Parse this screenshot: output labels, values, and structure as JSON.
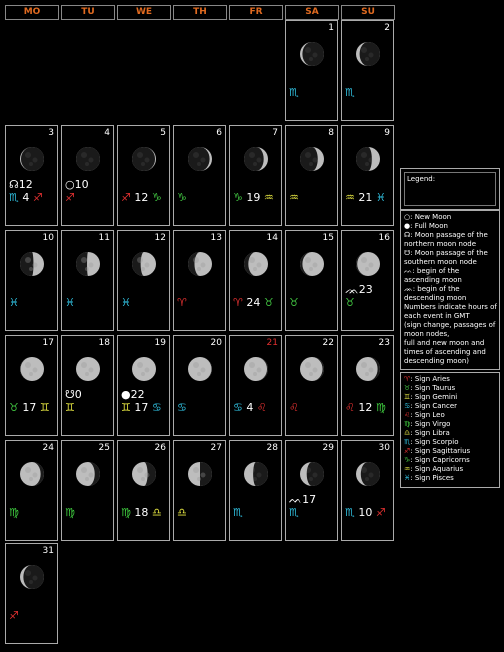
{
  "header": [
    "MO",
    "TU",
    "WE",
    "TH",
    "FR",
    "SA",
    "SU"
  ],
  "colors": {
    "header_text": "#e06a20",
    "holiday": "#e03030",
    "aries": "#e03030",
    "taurus": "#40c040",
    "gemini": "#e0e040",
    "cancer": "#30c0e0",
    "leo": "#e03030",
    "virgo": "#40d040",
    "libra": "#e0e040",
    "scorpio": "#30c0e0",
    "sagittarius": "#e03030",
    "capricorn": "#40c040",
    "aquarius": "#e0e040",
    "pisces": "#30c0e0"
  },
  "days": [
    {
      "n": "1",
      "row": 0,
      "col": 5,
      "phase": 0.9,
      "waxing": false,
      "sign": [
        {
          "g": "♏",
          "c": "scorpio"
        }
      ]
    },
    {
      "n": "2",
      "row": 0,
      "col": 6,
      "phase": 0.85,
      "waxing": false,
      "sign": [
        {
          "g": "♏",
          "c": "scorpio"
        }
      ]
    },
    {
      "n": "3",
      "row": 1,
      "col": 0,
      "phase": 0.96,
      "waxing": false,
      "event": "☊12",
      "sign": [
        {
          "g": "♏",
          "c": "scorpio"
        },
        {
          "t": " 4 "
        },
        {
          "g": "♐",
          "c": "sagittarius"
        }
      ]
    },
    {
      "n": "4",
      "row": 1,
      "col": 1,
      "phase": 1.0,
      "waxing": true,
      "event": "○10",
      "sign": [
        {
          "g": "♐",
          "c": "sagittarius"
        }
      ]
    },
    {
      "n": "5",
      "row": 1,
      "col": 2,
      "phase": 0.96,
      "waxing": true,
      "sign": [
        {
          "g": "♐",
          "c": "sagittarius"
        },
        {
          "t": " 12 "
        },
        {
          "g": "♑",
          "c": "capricorn"
        }
      ]
    },
    {
      "n": "6",
      "row": 1,
      "col": 3,
      "phase": 0.9,
      "waxing": true,
      "sign": [
        {
          "g": "♑",
          "c": "capricorn"
        }
      ]
    },
    {
      "n": "7",
      "row": 1,
      "col": 4,
      "phase": 0.82,
      "waxing": true,
      "sign": [
        {
          "g": "♑",
          "c": "capricorn"
        },
        {
          "t": " 19 "
        },
        {
          "g": "♒",
          "c": "aquarius"
        }
      ]
    },
    {
      "n": "8",
      "row": 1,
      "col": 5,
      "phase": 0.74,
      "waxing": true,
      "sign": [
        {
          "g": "♒",
          "c": "aquarius"
        }
      ]
    },
    {
      "n": "9",
      "row": 1,
      "col": 6,
      "phase": 0.66,
      "waxing": true,
      "sign": [
        {
          "g": "♒",
          "c": "aquarius"
        },
        {
          "t": " 21 "
        },
        {
          "g": "♓",
          "c": "pisces"
        }
      ]
    },
    {
      "n": "10",
      "row": 2,
      "col": 0,
      "phase": 0.56,
      "waxing": true,
      "sign": [
        {
          "g": "♓",
          "c": "pisces"
        }
      ]
    },
    {
      "n": "11",
      "row": 2,
      "col": 1,
      "phase": 0.46,
      "waxing": true,
      "sign": [
        {
          "g": "♓",
          "c": "pisces"
        }
      ]
    },
    {
      "n": "12",
      "row": 2,
      "col": 2,
      "phase": 0.36,
      "waxing": true,
      "sign": [
        {
          "g": "♓",
          "c": "pisces"
        }
      ]
    },
    {
      "n": "13",
      "row": 2,
      "col": 3,
      "phase": 0.27,
      "waxing": true,
      "sign": [
        {
          "g": "♈",
          "c": "aries"
        }
      ]
    },
    {
      "n": "14",
      "row": 2,
      "col": 4,
      "phase": 0.18,
      "waxing": true,
      "sign": [
        {
          "g": "♈",
          "c": "aries"
        },
        {
          "t": " 24 "
        },
        {
          "g": "♉",
          "c": "taurus"
        }
      ]
    },
    {
      "n": "15",
      "row": 2,
      "col": 5,
      "phase": 0.1,
      "waxing": true,
      "sign": [
        {
          "g": "♉",
          "c": "taurus"
        }
      ]
    },
    {
      "n": "16",
      "row": 2,
      "col": 6,
      "phase": 0.05,
      "waxing": true,
      "event": "ᨏ23",
      "sign": [
        {
          "g": "♉",
          "c": "taurus"
        }
      ]
    },
    {
      "n": "17",
      "row": 3,
      "col": 0,
      "phase": 0.02,
      "waxing": true,
      "sign": [
        {
          "g": "♉",
          "c": "taurus"
        },
        {
          "t": " 17 "
        },
        {
          "g": "♊",
          "c": "gemini"
        }
      ]
    },
    {
      "n": "18",
      "row": 3,
      "col": 1,
      "phase": 0.0,
      "waxing": true,
      "event": "☋0",
      "sign": [
        {
          "g": "♊",
          "c": "gemini"
        }
      ]
    },
    {
      "n": "19",
      "row": 3,
      "col": 2,
      "phase": 0.0,
      "waxing": true,
      "event": "●22",
      "sign": [
        {
          "g": "♊",
          "c": "gemini"
        },
        {
          "t": " 17 "
        },
        {
          "g": "♋",
          "c": "cancer"
        }
      ]
    },
    {
      "n": "20",
      "row": 3,
      "col": 3,
      "phase": 0.02,
      "waxing": false,
      "sign": [
        {
          "g": "♋",
          "c": "cancer"
        }
      ]
    },
    {
      "n": "21",
      "row": 3,
      "col": 4,
      "red": true,
      "phase": 0.04,
      "waxing": false,
      "sign": [
        {
          "g": "♋",
          "c": "cancer"
        },
        {
          "t": " 4 "
        },
        {
          "g": "♌",
          "c": "leo"
        }
      ]
    },
    {
      "n": "22",
      "row": 3,
      "col": 5,
      "phase": 0.06,
      "waxing": false,
      "sign": [
        {
          "g": "♌",
          "c": "leo"
        }
      ]
    },
    {
      "n": "23",
      "row": 3,
      "col": 6,
      "phase": 0.1,
      "waxing": false,
      "sign": [
        {
          "g": "♌",
          "c": "leo"
        },
        {
          "t": " 12 "
        },
        {
          "g": "♍",
          "c": "virgo"
        }
      ]
    },
    {
      "n": "24",
      "row": 4,
      "col": 0,
      "phase": 0.14,
      "waxing": false,
      "sign": [
        {
          "g": "♍",
          "c": "virgo"
        }
      ]
    },
    {
      "n": "25",
      "row": 4,
      "col": 1,
      "phase": 0.22,
      "waxing": false,
      "sign": [
        {
          "g": "♍",
          "c": "virgo"
        }
      ]
    },
    {
      "n": "26",
      "row": 4,
      "col": 2,
      "phase": 0.35,
      "waxing": false,
      "sign": [
        {
          "g": "♍",
          "c": "virgo"
        },
        {
          "t": " 18 "
        },
        {
          "g": "♎",
          "c": "libra"
        }
      ]
    },
    {
      "n": "27",
      "row": 4,
      "col": 3,
      "phase": 0.5,
      "waxing": false,
      "sign": [
        {
          "g": "♎",
          "c": "libra"
        }
      ]
    },
    {
      "n": "28",
      "row": 4,
      "col": 4,
      "phase": 0.62,
      "waxing": false,
      "sign": [
        {
          "g": "♏",
          "c": "scorpio"
        }
      ]
    },
    {
      "n": "29",
      "row": 4,
      "col": 5,
      "phase": 0.72,
      "waxing": false,
      "event": "ᨓ17",
      "sign": [
        {
          "g": "♏",
          "c": "scorpio"
        }
      ]
    },
    {
      "n": "30",
      "row": 4,
      "col": 6,
      "phase": 0.8,
      "waxing": false,
      "sign": [
        {
          "g": "♏",
          "c": "scorpio"
        },
        {
          "t": " 10 "
        },
        {
          "g": "♐",
          "c": "sagittarius"
        }
      ]
    },
    {
      "n": "31",
      "row": 5,
      "col": 0,
      "phase": 0.86,
      "waxing": false,
      "sign": [
        {
          "g": "♐",
          "c": "sagittarius"
        }
      ]
    }
  ],
  "legend": {
    "title": "Legend:",
    "items": [
      "○: New Moon",
      "●: Full Moon",
      "☊: Moon passage of the northern moon node",
      "☋: Moon passage of the southern moon node",
      "ᨓ: begin of the ascending moon",
      "ᨏ: begin of the descending moon",
      "Numbers indicate hours of each event in GMT",
      "(sign change, passages of moon nodes,",
      "full and new moon and times of ascending and descending moon)"
    ],
    "signs": [
      {
        "g": "♈",
        "c": "aries",
        "label": ": Sign Aries"
      },
      {
        "g": "♉",
        "c": "taurus",
        "label": ": Sign Taurus"
      },
      {
        "g": "♊",
        "c": "gemini",
        "label": ": Sign Gemini"
      },
      {
        "g": "♋",
        "c": "cancer",
        "label": ": Sign Cancer"
      },
      {
        "g": "♌",
        "c": "leo",
        "label": ": Sign Leo"
      },
      {
        "g": "♍",
        "c": "virgo",
        "label": ": Sign Virgo"
      },
      {
        "g": "♎",
        "c": "libra",
        "label": ": Sign Libra"
      },
      {
        "g": "♏",
        "c": "scorpio",
        "label": ": Sign Scorpio"
      },
      {
        "g": "♐",
        "c": "sagittarius",
        "label": ": Sign Sagittarius"
      },
      {
        "g": "♑",
        "c": "capricorn",
        "label": ": Sign Capricorns"
      },
      {
        "g": "♒",
        "c": "aquarius",
        "label": ": Sign Aquarius"
      },
      {
        "g": "♓",
        "c": "pisces",
        "label": ": Sign Pisces"
      }
    ]
  }
}
